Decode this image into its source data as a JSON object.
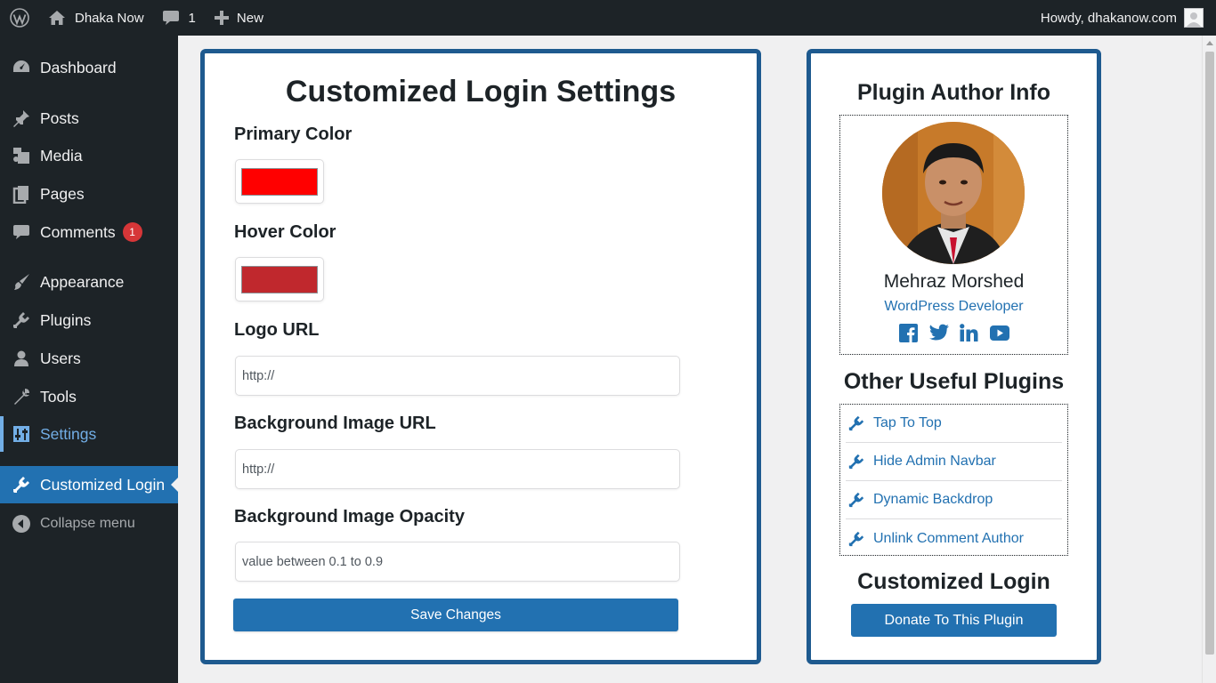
{
  "adminbar": {
    "site_name": "Dhaka Now",
    "comments_count": "1",
    "new_label": "New",
    "greeting": "Howdy, dhakanow.com"
  },
  "sidebar": {
    "items": [
      {
        "label": "Dashboard",
        "icon": "dashboard-icon"
      },
      {
        "label": "Posts",
        "icon": "pin-icon"
      },
      {
        "label": "Media",
        "icon": "media-icon"
      },
      {
        "label": "Pages",
        "icon": "pages-icon"
      },
      {
        "label": "Comments",
        "icon": "comment-icon",
        "badge": "1"
      },
      {
        "label": "Appearance",
        "icon": "brush-icon"
      },
      {
        "label": "Plugins",
        "icon": "plugin-icon"
      },
      {
        "label": "Users",
        "icon": "user-icon"
      },
      {
        "label": "Tools",
        "icon": "wrench-icon"
      },
      {
        "label": "Settings",
        "icon": "settings-icon"
      },
      {
        "label": "Customized Login",
        "icon": "plugin-icon"
      },
      {
        "label": "Collapse menu",
        "icon": "collapse-icon"
      }
    ],
    "active": "Customized Login"
  },
  "settings": {
    "title": "Customized Login Settings",
    "primary_color_label": "Primary Color",
    "primary_color": "#ff0000",
    "hover_color_label": "Hover Color",
    "hover_color": "#c0282d",
    "logo_url_label": "Logo URL",
    "logo_url_placeholder": "http://",
    "bg_image_label": "Background Image URL",
    "bg_image_placeholder": "http://",
    "opacity_label": "Background Image Opacity",
    "opacity_placeholder": "value between 0.1 to 0.9",
    "save_label": "Save Changes"
  },
  "author": {
    "heading": "Plugin Author Info",
    "name": "Mehraz Morshed",
    "role": "WordPress Developer",
    "socials": [
      "facebook-icon",
      "twitter-icon",
      "linkedin-icon",
      "youtube-icon"
    ]
  },
  "plugins": {
    "heading": "Other Useful Plugins",
    "items": [
      "Tap To Top",
      "Hide Admin Navbar",
      "Dynamic Backdrop",
      "Unlink Comment Author"
    ]
  },
  "donate": {
    "heading": "Customized Login",
    "button_label": "Donate To This Plugin"
  },
  "colors": {
    "accent": "#2271b1",
    "card_border": "#1e5a8f",
    "sidebar_bg": "#1d2327"
  }
}
